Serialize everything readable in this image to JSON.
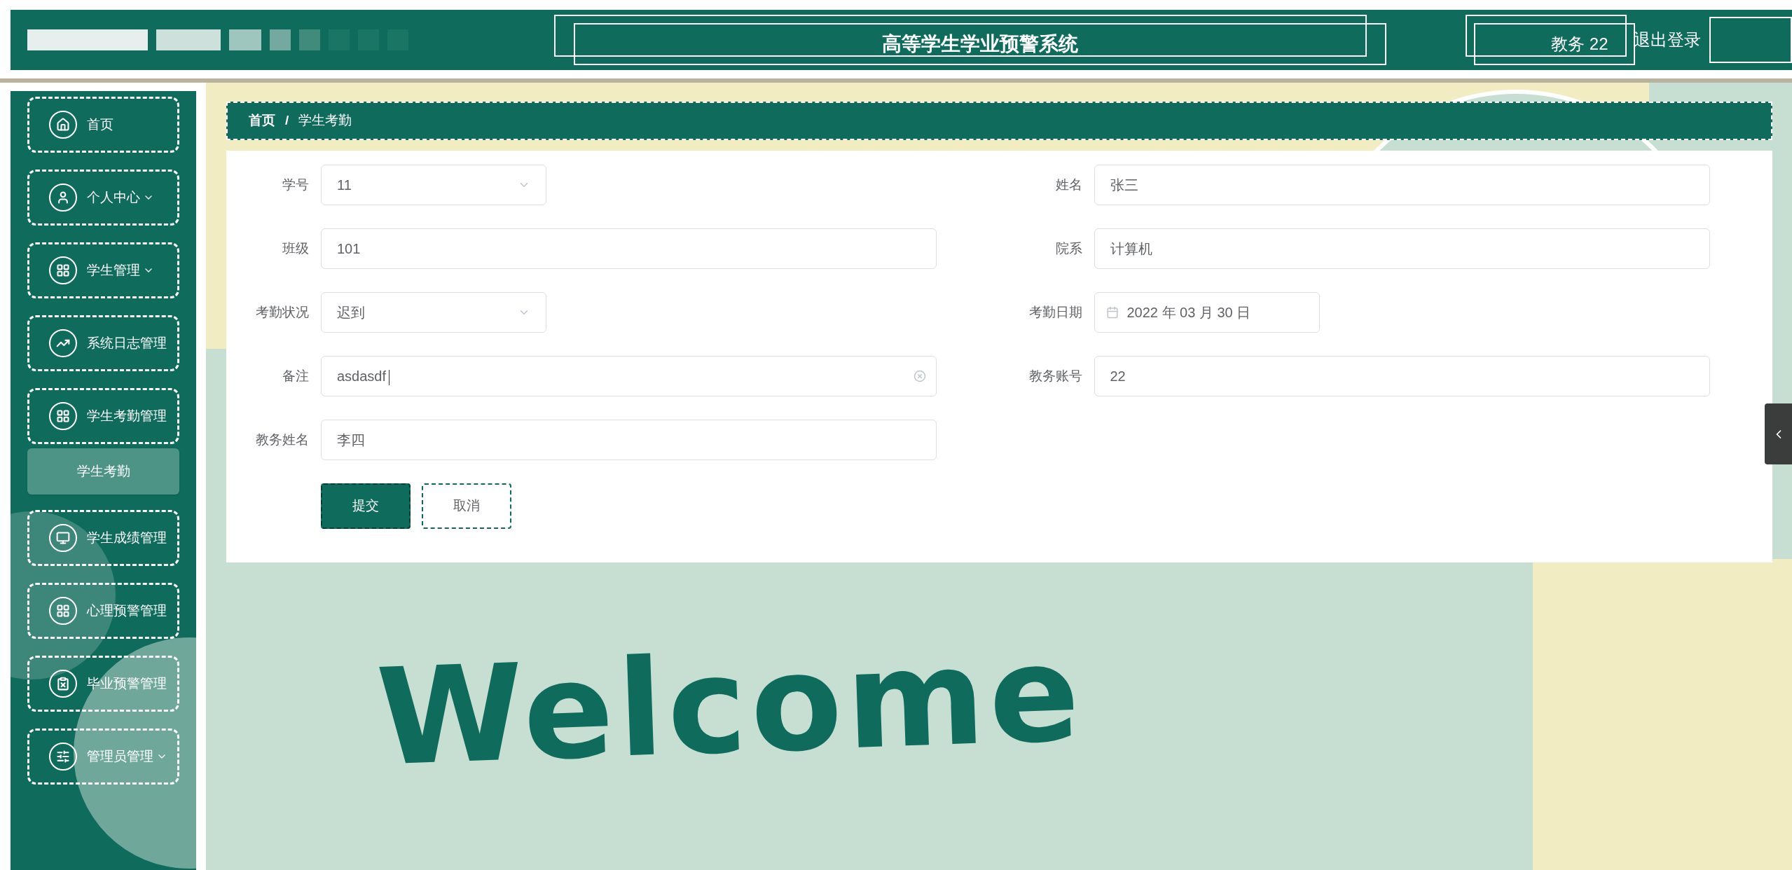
{
  "header": {
    "title": "高等学生学业预警系统",
    "user": "教务 22",
    "logout": "退出登录"
  },
  "sidebar": {
    "items": [
      {
        "label": "首页",
        "kind": "home",
        "caret": false
      },
      {
        "label": "个人中心",
        "kind": "user",
        "caret": true
      },
      {
        "label": "学生管理",
        "kind": "grid",
        "caret": true
      },
      {
        "label": "系统日志管理",
        "kind": "chart",
        "caret": false
      },
      {
        "label": "学生考勤管理",
        "kind": "grid",
        "caret": false,
        "children": [
          {
            "label": "学生考勤",
            "selected": true
          }
        ]
      },
      {
        "label": "学生成绩管理",
        "kind": "screen",
        "caret": false
      },
      {
        "label": "心理预警管理",
        "kind": "grid",
        "caret": false
      },
      {
        "label": "毕业预警管理",
        "kind": "clipboard",
        "caret": false
      },
      {
        "label": "管理员管理",
        "kind": "sliders",
        "caret": true
      }
    ]
  },
  "breadcrumb": {
    "separator": "/",
    "items": [
      "首页",
      "学生考勤"
    ]
  },
  "form": {
    "fields": [
      {
        "label": "学号",
        "value": "11",
        "kind": "select"
      },
      {
        "label": "姓名",
        "value": "张三",
        "kind": "text"
      },
      {
        "label": "班级",
        "value": "101",
        "kind": "text"
      },
      {
        "label": "院系",
        "value": "计算机",
        "kind": "text"
      },
      {
        "label": "考勤状况",
        "value": "迟到",
        "kind": "select"
      },
      {
        "label": "考勤日期",
        "value": "2022 年 03 月 30 日",
        "kind": "date"
      },
      {
        "label": "备注",
        "value": "asdasdf",
        "kind": "clearable"
      },
      {
        "label": "教务账号",
        "value": "22",
        "kind": "text"
      },
      {
        "label": "教务姓名",
        "value": "李四",
        "kind": "text"
      }
    ],
    "buttons": [
      {
        "label": "提交",
        "kind": "primary"
      },
      {
        "label": "取消",
        "kind": "default"
      }
    ]
  },
  "banner": "Welcome"
}
